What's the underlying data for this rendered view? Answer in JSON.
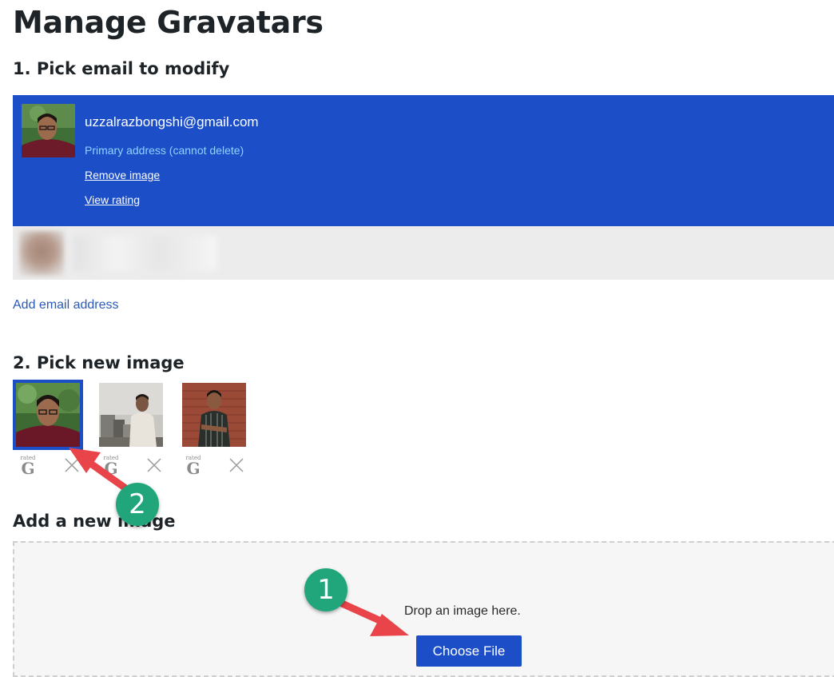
{
  "page": {
    "title": "Manage Gravatars"
  },
  "section1": {
    "heading": "1. Pick email to modify",
    "selected_email": {
      "address": "uzzalrazbongshi@gmail.com",
      "status": "Primary address (cannot delete)",
      "remove_label": "Remove image",
      "rating_label": "View rating"
    },
    "add_email_label": "Add email address"
  },
  "section2": {
    "heading": "2. Pick new image",
    "images": [
      {
        "rating_small": "rated",
        "rating_big": "G",
        "selected": true
      },
      {
        "rating_small": "rated",
        "rating_big": "G",
        "selected": false
      },
      {
        "rating_small": "rated",
        "rating_big": "G",
        "selected": false
      }
    ]
  },
  "section3": {
    "heading": "Add a new image",
    "drop_text": "Drop an image here.",
    "choose_label": "Choose File"
  },
  "annotations": {
    "badge1": "1",
    "badge2": "2"
  },
  "colors": {
    "selected_blue": "#1c4ec8",
    "primary_note": "#8fd3ff",
    "link_blue": "#2a5ab8",
    "badge_green": "#20a67a",
    "arrow_red": "#e8444a"
  }
}
